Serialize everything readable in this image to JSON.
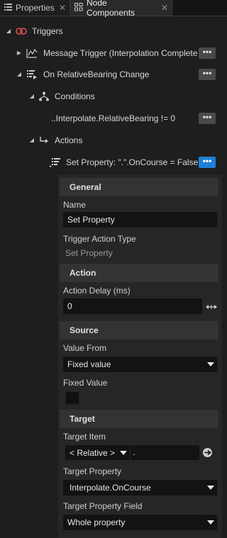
{
  "tabs": [
    {
      "label": "Properties",
      "icon": "list-icon",
      "close": "✕"
    },
    {
      "label": "Node Components",
      "icon": "components-icon",
      "close": "✕"
    }
  ],
  "tree": {
    "triggers": {
      "label": "Triggers",
      "icon": "triggers-icon",
      "color": "#e05050"
    },
    "message_trigger": {
      "label": "Message Trigger (Interpolation Completed)",
      "more": "•••"
    },
    "on_change": {
      "label": "On RelativeBearing Change",
      "more": "•••"
    },
    "conditions": {
      "label": "Conditions"
    },
    "condition_expr": {
      "label": "..Interpolate.RelativeBearing != 0",
      "more": "•••"
    },
    "actions": {
      "label": "Actions"
    },
    "set_property": {
      "label": "Set Property: \".\".OnCourse = False",
      "more": "•••",
      "accent": "#1e7fd6"
    }
  },
  "editor": {
    "general": {
      "header": "General",
      "name_label": "Name",
      "name_value": "Set Property",
      "type_label": "Trigger Action Type",
      "type_value": "Set Property"
    },
    "action": {
      "header": "Action",
      "delay_label": "Action Delay (ms)",
      "delay_value": "0",
      "drag_icon": "horizontal-drag-icon"
    },
    "source": {
      "header": "Source",
      "value_from_label": "Value From",
      "value_from_selected": "Fixed value",
      "fixed_value_label": "Fixed Value",
      "fixed_value_checked": false
    },
    "target": {
      "header": "Target",
      "item_label": "Target Item",
      "item_relative": "< Relative >",
      "item_path": ".",
      "property_label": "Target Property",
      "property_selected": "Interpolate.OnCourse",
      "field_label": "Target Property Field",
      "field_selected": "Whole property"
    }
  }
}
